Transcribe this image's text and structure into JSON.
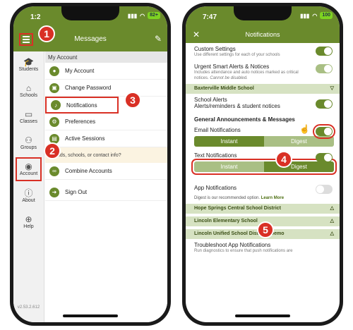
{
  "left_phone": {
    "status_time": "1:2",
    "battery": "82+",
    "header_title": "Messages",
    "sidebar": [
      {
        "label": "Students",
        "icon": "graduation-cap-icon"
      },
      {
        "label": "Schools",
        "icon": "school-icon"
      },
      {
        "label": "Classes",
        "icon": "classes-icon"
      },
      {
        "label": "Groups",
        "icon": "groups-icon"
      },
      {
        "label": "Account",
        "icon": "account-icon"
      },
      {
        "label": "About",
        "icon": "info-icon"
      },
      {
        "label": "Help",
        "icon": "help-icon"
      }
    ],
    "version": "v2.53.2.612",
    "menu_header": "My Account",
    "menu": [
      {
        "label": "My Account"
      },
      {
        "label": "Change Password"
      },
      {
        "label": "Notifications"
      },
      {
        "label": "Preferences"
      },
      {
        "label": "Active Sessions"
      }
    ],
    "prompt": "g kids, schools, or contact info?",
    "combine_label": "Combine Accounts",
    "signout_label": "Sign Out"
  },
  "right_phone": {
    "status_time": "7:47",
    "battery": "100",
    "header_title": "Notifications",
    "custom_settings": {
      "title": "Custom Settings",
      "subtitle": "Use different settings for each of your schools"
    },
    "urgent": {
      "title": "Urgent Smart Alerts & Notices",
      "subtitle": "Includes attendance and auto notices marked as critical notices.",
      "subtitle_em": "Cannot be disabled."
    },
    "school_band": "Baxterville Middle School",
    "school_alerts": {
      "title": "School Alerts",
      "subtitle": "Alerts/reminders & student notices"
    },
    "general_heading": "General Announcements & Messages",
    "email": {
      "label": "Email Notifications",
      "instant": "Instant",
      "digest": "Digest"
    },
    "text": {
      "label": "Text Notifications",
      "instant": "Instant",
      "digest": "Digest"
    },
    "app": {
      "label": "App Notifications"
    },
    "hint": "Digest is our recommended option.",
    "hint_link": "Learn More",
    "bands": [
      "Hope Springs Central School District",
      "Lincoln Elementary School",
      "Lincoln Unified School District - Demo"
    ],
    "troubleshoot": {
      "title": "Troubleshoot App Notifications",
      "subtitle": "Run diagnostics to ensure that push notifications are"
    }
  },
  "callouts": [
    "1",
    "2",
    "3",
    "4",
    "5"
  ],
  "colors": {
    "brand_green": "#6a8a2c",
    "callout_red": "#d93025"
  }
}
